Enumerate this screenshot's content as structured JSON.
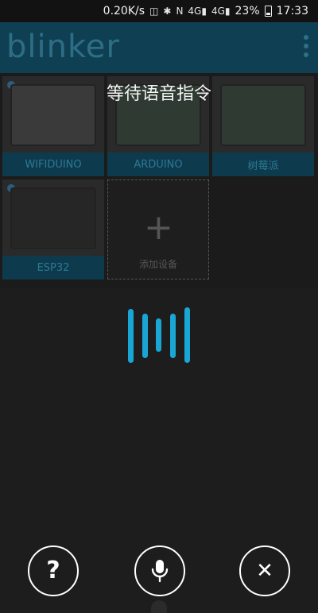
{
  "status_bar": {
    "speed": "0.20K/s",
    "network_4g_a": "4G",
    "network_4g_b": "4G",
    "battery_percent": "23%",
    "time": "17:33"
  },
  "app": {
    "logo": "blinker"
  },
  "devices": [
    {
      "label": "WIFIDUINO"
    },
    {
      "label": "ARDUINO"
    },
    {
      "label": "树莓派"
    },
    {
      "label": "ESP32"
    }
  ],
  "add_device": {
    "label": "添加设备"
  },
  "overlay": {
    "title": "等待语音指令"
  },
  "buttons": {
    "help_glyph": "?",
    "close_glyph": "✕"
  },
  "colors": {
    "accent": "#1aa6d4",
    "header": "#0f3f52"
  }
}
